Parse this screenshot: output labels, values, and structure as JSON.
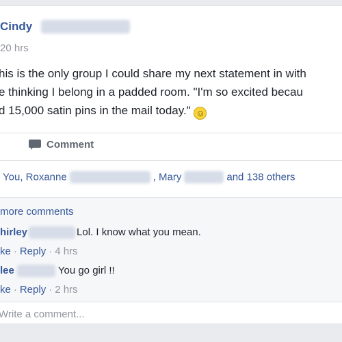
{
  "post": {
    "author_first": "Cindy",
    "time": "20 hrs",
    "text_lines": [
      "his is the only group I could share my next statement in with",
      "e thinking I belong in a padded room. \"I'm so excited becau",
      "d 15,000 satin pins in the mail today.\""
    ],
    "emoji_name": "smile-emoji"
  },
  "actions": {
    "comment_label": "Comment"
  },
  "reactions": {
    "part1": "You, Roxanne",
    "part2": ", Mary",
    "part3": "and 138 others"
  },
  "comments": {
    "more_label": "more comments",
    "items": [
      {
        "name": "hirley",
        "text": "Lol. I know what you mean.",
        "like": "ke",
        "reply": "Reply",
        "time": "4 hrs"
      },
      {
        "name": "lee",
        "text": "You go girl !!",
        "like": "ke",
        "reply": "Reply",
        "time": "2 hrs"
      }
    ],
    "separator": "·",
    "write_placeholder": "Write a comment..."
  },
  "colors": {
    "link": "#365899",
    "meta": "#90949c",
    "background": "#e9ebee"
  }
}
